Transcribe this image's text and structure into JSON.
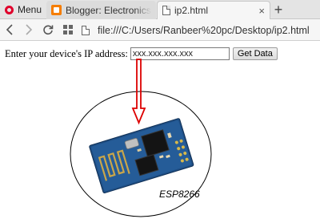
{
  "browser": {
    "menu_label": "Menu",
    "tabs": [
      {
        "title": "Blogger: Electronics & ",
        "active": false
      },
      {
        "title": "ip2.html",
        "active": true
      }
    ],
    "close_glyph": "×",
    "new_tab_glyph": "+",
    "url": "file:///C:/Users/Ranbeer%20pc/Desktop/ip2.html",
    "opera_color": "#e0002b",
    "blogger_color": "#f57d00"
  },
  "page": {
    "prompt": "Enter your device's IP address:",
    "ip_placeholder": "xxx.xxx.xxx.xxx",
    "ip_value": "",
    "button_label": "Get Data",
    "figure_label": "ESP8266",
    "arrow_color": "#dd0000"
  }
}
